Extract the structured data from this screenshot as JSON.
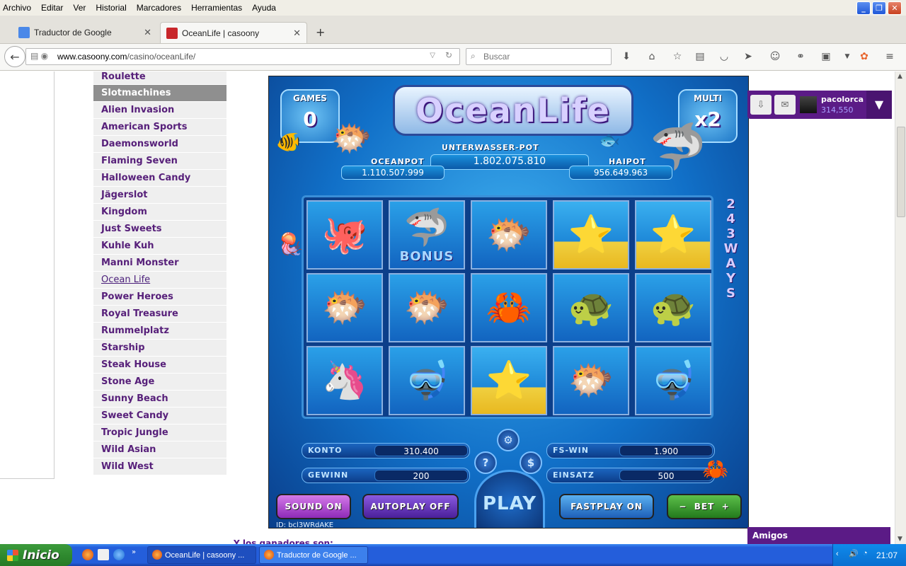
{
  "menu": [
    "Archivo",
    "Editar",
    "Ver",
    "Historial",
    "Marcadores",
    "Herramientas",
    "Ayuda"
  ],
  "tabs": [
    {
      "title": "Traductor de Google",
      "active": false
    },
    {
      "title": "OceanLife | casoony",
      "active": true
    }
  ],
  "url": {
    "domain": "www.casoony.com",
    "path": "/casino/oceanLife/"
  },
  "search_placeholder": "Buscar",
  "games": {
    "first": "Roulette",
    "header": "Slotmachines",
    "items": [
      "Alien Invasion",
      "American Sports",
      "Daemonsworld",
      "Flaming Seven",
      "Halloween Candy",
      "Jägerslot",
      "Kingdom",
      "Just Sweets",
      "Kuhle Kuh",
      "Manni Monster",
      "Ocean Life",
      "Power Heroes",
      "Royal Treasure",
      "Rummelplatz",
      "Starship",
      "Steak House",
      "Stone Age",
      "Sunny Beach",
      "Sweet Candy",
      "Tropic Jungle",
      "Wild Asian",
      "Wild West"
    ],
    "current": "Ocean Life"
  },
  "slot": {
    "title": "OceanLife",
    "games_label": "GAMES",
    "games_value": "0",
    "multi_label": "MULTI",
    "multi_value": "x2",
    "main_pot_label": "UNTERWASSER-POT",
    "main_pot": "1.802.075.810",
    "oceanpot_label": "OCEANPOT",
    "oceanpot": "1.110.507.999",
    "haipot_label": "HAIPOT",
    "haipot": "956.649.963",
    "ways": "243WAYS",
    "bonus_label": "BONUS",
    "reels": [
      [
        "octopus",
        "pufferfish",
        "seahorse"
      ],
      [
        "shark-bonus",
        "pufferfish",
        "diver"
      ],
      [
        "pufferfish",
        "crab",
        "starfish"
      ],
      [
        "starfish",
        "turtle",
        "pufferfish"
      ],
      [
        "starfish",
        "turtle",
        "diver"
      ]
    ],
    "konto_label": "KONTO",
    "konto": "310.400",
    "gewinn_label": "GEWINN",
    "gewinn": "200",
    "fswin_label": "FS-WIN",
    "fswin": "1.900",
    "einsatz_label": "EINSATZ",
    "einsatz": "500",
    "sound": "SOUND",
    "sound_state": "ON",
    "autoplay": "AUTOPLAY",
    "autoplay_state": "OFF",
    "play": "PLAY",
    "fastplay": "FASTPLAY",
    "fastplay_state": "ON",
    "bet": "BET",
    "id_text": "ID: bcl3WRdAKE"
  },
  "user": {
    "name": "pacolorca",
    "coins": "314,550"
  },
  "friends_label": "Amigos",
  "cut_text": "Y los ganadores son:",
  "taskbar": {
    "start": "Inicio",
    "tasks": [
      "OceanLife | casoony ...",
      "Traductor de Google ..."
    ],
    "time": "21:07"
  }
}
